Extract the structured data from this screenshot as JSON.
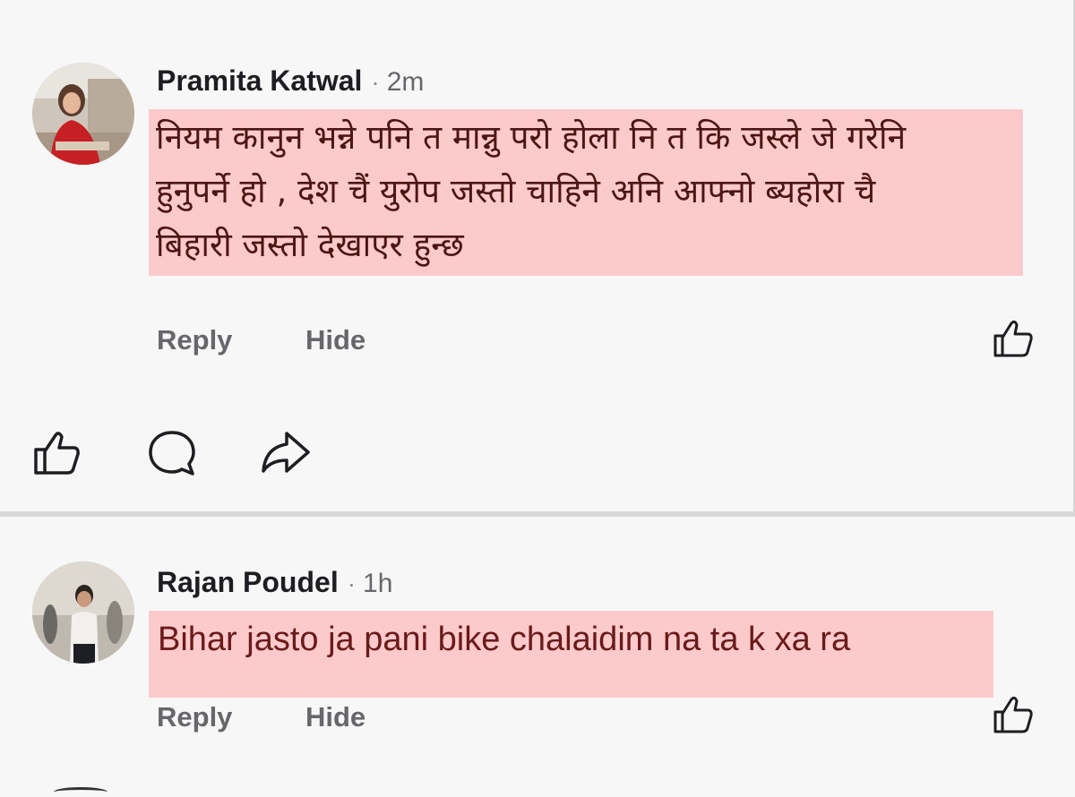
{
  "comments": [
    {
      "author": "Pramita Katwal",
      "separator": "·",
      "time": "2m",
      "text": "नियम कानुन भन्ने पनि त मान्नु परो होला नि त कि जस्ले जे गरेनि\nहुनुपर्ने हो , देश चैं युरोप जस्तो चाहिने अनि आफ्नो ब्यहोरा  चै\nबिहारी जस्तो देखाएर हुन्छ",
      "reply_label": "Reply",
      "hide_label": "Hide"
    },
    {
      "author": "Rajan Poudel",
      "separator": "·",
      "time": "1h",
      "text": "Bihar jasto ja pani bike chalaidim na ta k xa ra",
      "reply_label": "Reply",
      "hide_label": "Hide"
    }
  ],
  "post_actions": {
    "icons": [
      "like-icon",
      "comment-icon",
      "share-icon"
    ]
  },
  "colors": {
    "highlight": "#fccaca",
    "text": "#4e1515",
    "muted": "#65676b"
  }
}
